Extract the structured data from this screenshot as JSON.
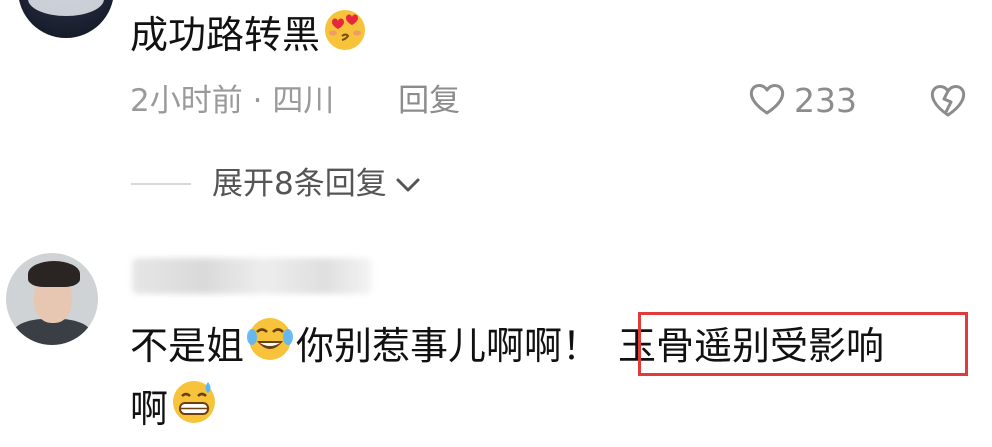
{
  "comment1": {
    "text": "成功路转黑",
    "emoji": "heart-eyes-kiss-emoji",
    "time": "2小时前",
    "separator": "·",
    "location": "四川",
    "reply_label": "回复",
    "like_count": "233"
  },
  "expand": {
    "label": "展开8条回复"
  },
  "comment2": {
    "text_part1": "不是姐",
    "emoji1": "crying-laughing-emoji",
    "text_part2": "你别惹事儿啊啊！",
    "highlighted": "玉骨遥别受影响",
    "text_line2": "啊",
    "emoji2": "sweat-grin-emoji"
  },
  "colors": {
    "meta_gray": "#9a9a9a",
    "highlight_red": "#e03a3a",
    "text": "#111111"
  }
}
